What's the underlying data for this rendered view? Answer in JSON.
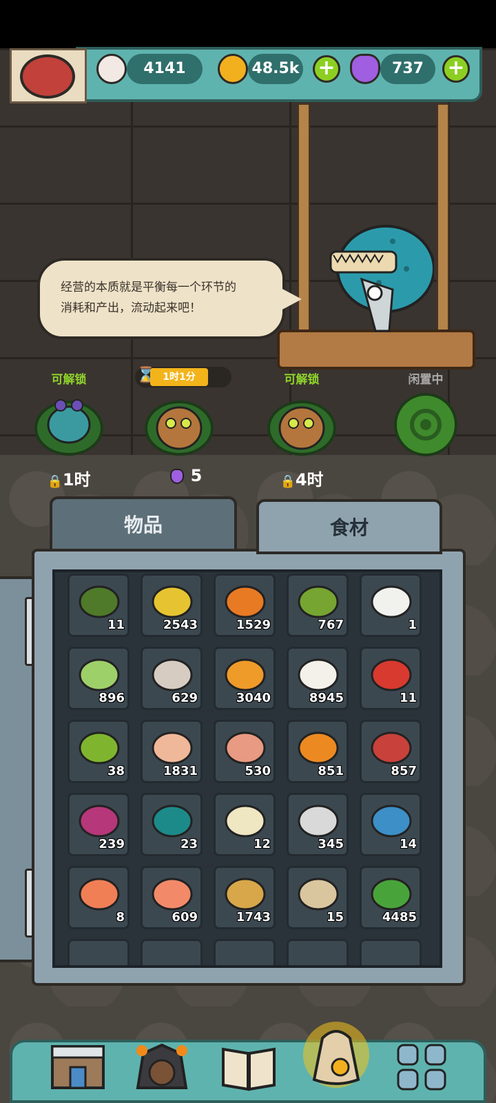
{
  "resources": {
    "eyes": {
      "icon": "eyeball-icon",
      "value": "4141"
    },
    "coins": {
      "icon": "coin-icon",
      "value": "48.5k"
    },
    "potions": {
      "icon": "potion-icon",
      "value": "737"
    }
  },
  "speech": {
    "line1": "经营的本质就是平衡每一个环节的",
    "line2": "消耗和产出，流动起来吧！"
  },
  "stations": [
    {
      "status": "可解锁",
      "cost": "1时",
      "icon": "lock-icon",
      "status_color": "#8fd42a"
    },
    {
      "status": "",
      "timer": "1时1分",
      "cost": "5",
      "icon": "potion-icon"
    },
    {
      "status": "可解锁",
      "cost": "4时",
      "icon": "lock-icon",
      "status_color": "#8fd42a"
    },
    {
      "status": "闲置中",
      "cost": "",
      "icon": "gear-icon",
      "status_color": "#a9a9a9"
    }
  ],
  "tabs": {
    "items": "物品",
    "ingredients": "食材",
    "active": "ingredients"
  },
  "inventory": [
    {
      "name": "seaweed-icon",
      "count": "11",
      "color": "#4f7a2a"
    },
    {
      "name": "corn-icon",
      "count": "2543",
      "color": "#e6c431"
    },
    {
      "name": "carrot-icon",
      "count": "1529",
      "color": "#e87a24"
    },
    {
      "name": "bitter-melon-icon",
      "count": "767",
      "color": "#76a532"
    },
    {
      "name": "rice-icon",
      "count": "1",
      "color": "#f1f1ee"
    },
    {
      "name": "cucumber-slice-icon",
      "count": "896",
      "color": "#9ed06a"
    },
    {
      "name": "oyster-icon",
      "count": "629",
      "color": "#d6ccc2"
    },
    {
      "name": "mushroom-icon",
      "count": "3040",
      "color": "#ee9b2a"
    },
    {
      "name": "salt-icon",
      "count": "8945",
      "color": "#f4f1ea"
    },
    {
      "name": "strawberry-icon",
      "count": "11",
      "color": "#d83a2f"
    },
    {
      "name": "peas-icon",
      "count": "38",
      "color": "#7fb52e"
    },
    {
      "name": "chicken-leg-icon",
      "count": "1831",
      "color": "#f0b89a"
    },
    {
      "name": "ham-icon",
      "count": "530",
      "color": "#e89a82"
    },
    {
      "name": "pumpkin-icon",
      "count": "851",
      "color": "#ec8a21"
    },
    {
      "name": "steak-icon",
      "count": "857",
      "color": "#c8413b"
    },
    {
      "name": "onion-icon",
      "count": "239",
      "color": "#b6377a"
    },
    {
      "name": "sea-urchin-icon",
      "count": "23",
      "color": "#1d8a8a"
    },
    {
      "name": "banana-icon",
      "count": "12",
      "color": "#efe6c2"
    },
    {
      "name": "milk-carton-icon",
      "count": "345",
      "color": "#d9d9d9"
    },
    {
      "name": "blue-crab-icon",
      "count": "14",
      "color": "#3c8fc7"
    },
    {
      "name": "shrimp-icon",
      "count": "8",
      "color": "#f07f56"
    },
    {
      "name": "salmon-icon",
      "count": "609",
      "color": "#f28a6a"
    },
    {
      "name": "potato-icon",
      "count": "1743",
      "color": "#d7a74a"
    },
    {
      "name": "conch-icon",
      "count": "15",
      "color": "#d9c69f"
    },
    {
      "name": "lettuce-icon",
      "count": "4485",
      "color": "#48a43a"
    }
  ],
  "nav": [
    {
      "name": "shop-nav-button",
      "icon": "storefront-icon"
    },
    {
      "name": "monster-nav-button",
      "icon": "monster-icon"
    },
    {
      "name": "recipe-book-nav-button",
      "icon": "book-icon"
    },
    {
      "name": "inventory-bag-nav-button",
      "icon": "bag-icon"
    },
    {
      "name": "more-nav-button",
      "icon": "grid-icon"
    }
  ]
}
